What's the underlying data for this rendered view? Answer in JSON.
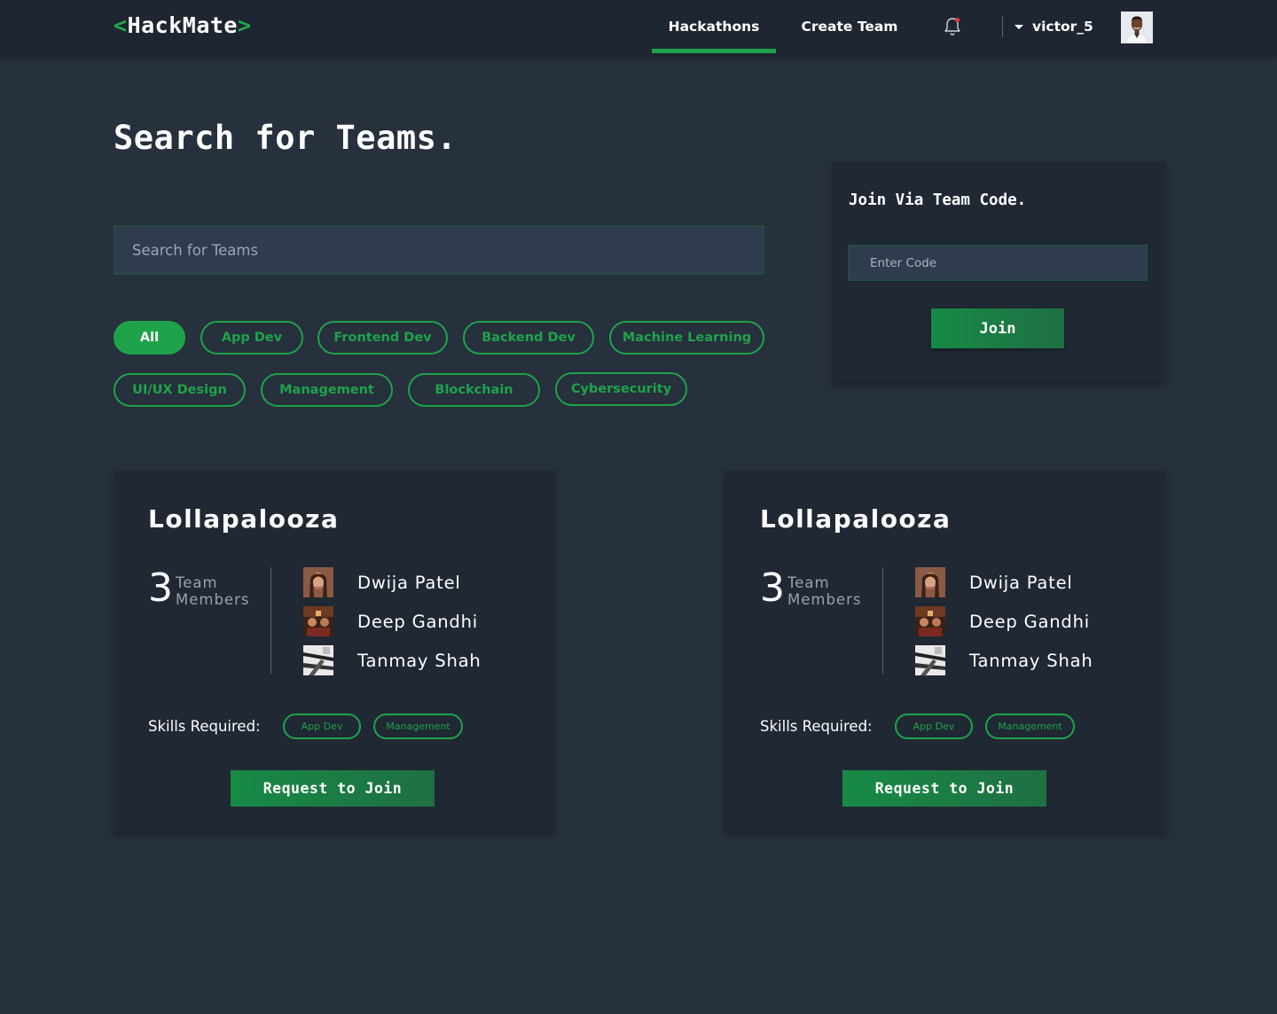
{
  "app": {
    "logo_open": "<",
    "logo_text": "HackMate",
    "logo_close": ">"
  },
  "nav": {
    "items": [
      {
        "label": "Hackathons",
        "active": true
      },
      {
        "label": "Create Team",
        "active": false
      }
    ],
    "notification_icon": "bell-icon",
    "username": "victor_5",
    "avatar_icon": "user-avatar"
  },
  "page": {
    "title": "Search for Teams."
  },
  "search": {
    "placeholder": "Search for Teams",
    "value": ""
  },
  "filters": [
    {
      "label": "All",
      "active": true
    },
    {
      "label": "App Dev",
      "active": false
    },
    {
      "label": "Frontend Dev",
      "active": false
    },
    {
      "label": "Backend Dev",
      "active": false
    },
    {
      "label": "Machine Learning",
      "active": false
    },
    {
      "label": "UI/UX Design",
      "active": false
    },
    {
      "label": "Management",
      "active": false
    },
    {
      "label": "Blockchain",
      "active": false
    },
    {
      "label": "Cybersecurity",
      "active": false
    }
  ],
  "join_code": {
    "title": "Join Via Team Code.",
    "placeholder": "Enter Code",
    "button_label": "Join"
  },
  "teams": [
    {
      "name": "Lollapalooza",
      "member_count": "3",
      "member_label": "Team Members",
      "members": [
        {
          "name": "Dwija Patel",
          "avatar": "member-photo"
        },
        {
          "name": "Deep Gandhi",
          "avatar": "member-photo"
        },
        {
          "name": "Tanmay Shah",
          "avatar": "member-photo"
        }
      ],
      "skills_label": "Skills Required:",
      "skills": [
        "App Dev",
        "Management"
      ],
      "button_label": "Request to Join"
    },
    {
      "name": "Lollapalooza",
      "member_count": "3",
      "member_label": "Team Members",
      "members": [
        {
          "name": "Dwija Patel",
          "avatar": "member-photo"
        },
        {
          "name": "Deep Gandhi",
          "avatar": "member-photo"
        },
        {
          "name": "Tanmay Shah",
          "avatar": "member-photo"
        }
      ],
      "skills_label": "Skills Required:",
      "skills": [
        "App Dev",
        "Management"
      ],
      "button_label": "Request to Join"
    }
  ],
  "colors": {
    "background": "#27303d",
    "topbar": "#1e2631",
    "card": "#1f2833",
    "accent_green": "#1ea34a",
    "input_bg": "#2f3c4e"
  }
}
